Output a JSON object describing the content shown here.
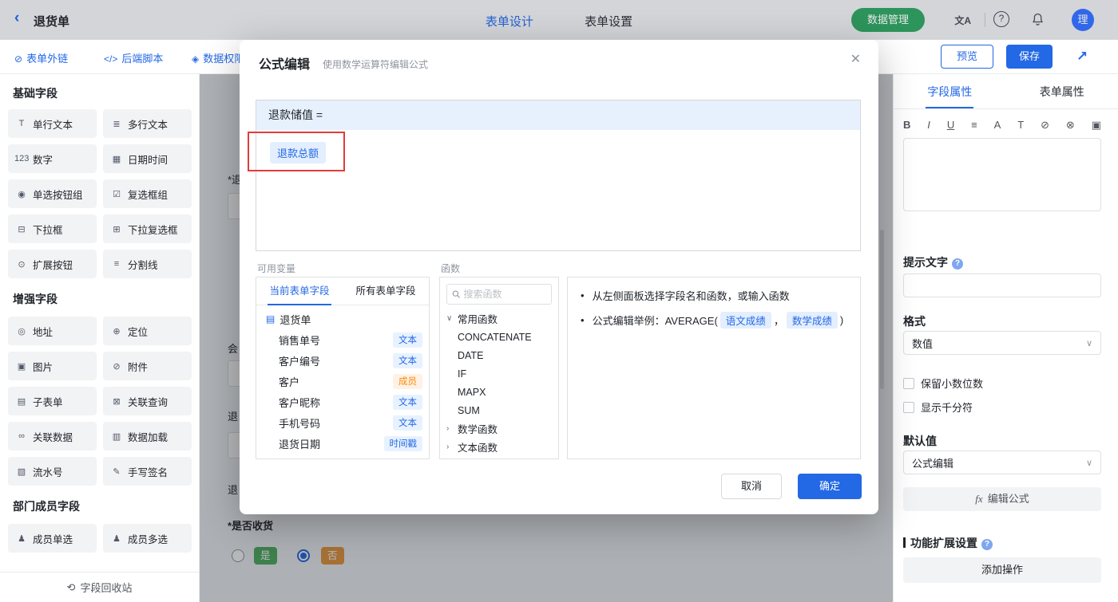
{
  "colors": {
    "primary": "#2368E4",
    "green": "#2EA160",
    "orange_badge": "#FF8800",
    "annotation_red": "#E23B3B"
  },
  "icons": {
    "back": "‹",
    "translate": "文A",
    "help": "?",
    "share": "↗",
    "link": "⊘",
    "script": "</>",
    "permission": "◈",
    "recycle": "⟲",
    "doc": "▤",
    "chevron_down": "∨",
    "chevron_right": "›",
    "close": "✕",
    "fx": "fx"
  },
  "header": {
    "title": "退货单",
    "tab_design": "表单设计",
    "tab_settings": "表单设置",
    "data_manage": "数据管理",
    "avatar": "理"
  },
  "toolbar": {
    "external_link": "表单外链",
    "backend_script": "后端脚本",
    "data_permission": "数据权限",
    "preview": "预览",
    "save": "保存"
  },
  "sidebar": {
    "sections": [
      {
        "title": "基础字段",
        "fields": [
          {
            "icon": "T",
            "label": "单行文本"
          },
          {
            "icon": "≣",
            "label": "多行文本"
          },
          {
            "icon": "123",
            "label": "数字"
          },
          {
            "icon": "▦",
            "label": "日期时间"
          },
          {
            "icon": "◉",
            "label": "单选按钮组"
          },
          {
            "icon": "☑",
            "label": "复选框组"
          },
          {
            "icon": "⊟",
            "label": "下拉框"
          },
          {
            "icon": "⊞",
            "label": "下拉复选框"
          },
          {
            "icon": "⊙",
            "label": "扩展按钮"
          },
          {
            "icon": "≡",
            "label": "分割线"
          }
        ]
      },
      {
        "title": "增强字段",
        "fields": [
          {
            "icon": "◎",
            "label": "地址"
          },
          {
            "icon": "⊕",
            "label": "定位"
          },
          {
            "icon": "▣",
            "label": "图片"
          },
          {
            "icon": "⊘",
            "label": "附件"
          },
          {
            "icon": "▤",
            "label": "子表单"
          },
          {
            "icon": "⊠",
            "label": "关联查询"
          },
          {
            "icon": "∞",
            "label": "关联数据"
          },
          {
            "icon": "▥",
            "label": "数据加载"
          },
          {
            "icon": "▧",
            "label": "流水号"
          },
          {
            "icon": "✎",
            "label": "手写签名"
          }
        ]
      },
      {
        "title": "部门成员字段",
        "fields": [
          {
            "icon": "♟",
            "label": "成员单选"
          },
          {
            "icon": "♟",
            "label": "成员多选"
          }
        ]
      }
    ],
    "recycle": "字段回收站"
  },
  "canvas": {
    "fragments": [
      "*退",
      "会",
      "退",
      "退"
    ],
    "receive_label": "*是否收货",
    "option_yes": "是",
    "option_no": "否"
  },
  "modal": {
    "title": "公式编辑",
    "subtitle": "使用数学运算符编辑公式",
    "formula_target": "退款储值 =",
    "formula_chip": "退款总额",
    "variables_label": "可用变量",
    "variables": {
      "tab_current": "当前表单字段",
      "tab_all": "所有表单字段",
      "root": "退货单",
      "items": [
        {
          "name": "销售单号",
          "type": "文本",
          "tone": "blue"
        },
        {
          "name": "客户编号",
          "type": "文本",
          "tone": "blue"
        },
        {
          "name": "客户",
          "type": "成员",
          "tone": "orange"
        },
        {
          "name": "客户昵称",
          "type": "文本",
          "tone": "blue"
        },
        {
          "name": "手机号码",
          "type": "文本",
          "tone": "blue"
        },
        {
          "name": "退货日期",
          "type": "时间戳",
          "tone": "blue"
        }
      ]
    },
    "functions_label": "函数",
    "functions": {
      "search_placeholder": "搜索函数",
      "group_common": "常用函数",
      "common": [
        "CONCATENATE",
        "DATE",
        "IF",
        "MAPX",
        "SUM"
      ],
      "group_math": "数学函数",
      "group_text": "文本函数"
    },
    "help": {
      "line1": "从左侧面板选择字段名和函数，或输入函数",
      "example_prefix": "公式编辑举例：AVERAGE(",
      "chip1": "语文成绩",
      "separator": "，",
      "chip2": "数学成绩",
      "example_suffix": ")"
    },
    "cancel": "取消",
    "confirm": "确定"
  },
  "right_panel": {
    "tab_field": "字段属性",
    "tab_form": "表单属性",
    "richtext_icons": [
      "B",
      "I",
      "U",
      "≡",
      "A",
      "T",
      "⊘",
      "⊗",
      "▣"
    ],
    "hint_label": "提示文字",
    "format_label": "格式",
    "format_value": "数值",
    "checkbox_decimal": "保留小数位数",
    "checkbox_thousand": "显示千分符",
    "default_label": "默认值",
    "default_value": "公式编辑",
    "edit_formula": "编辑公式",
    "extension_label": "功能扩展设置",
    "add_action": "添加操作"
  }
}
